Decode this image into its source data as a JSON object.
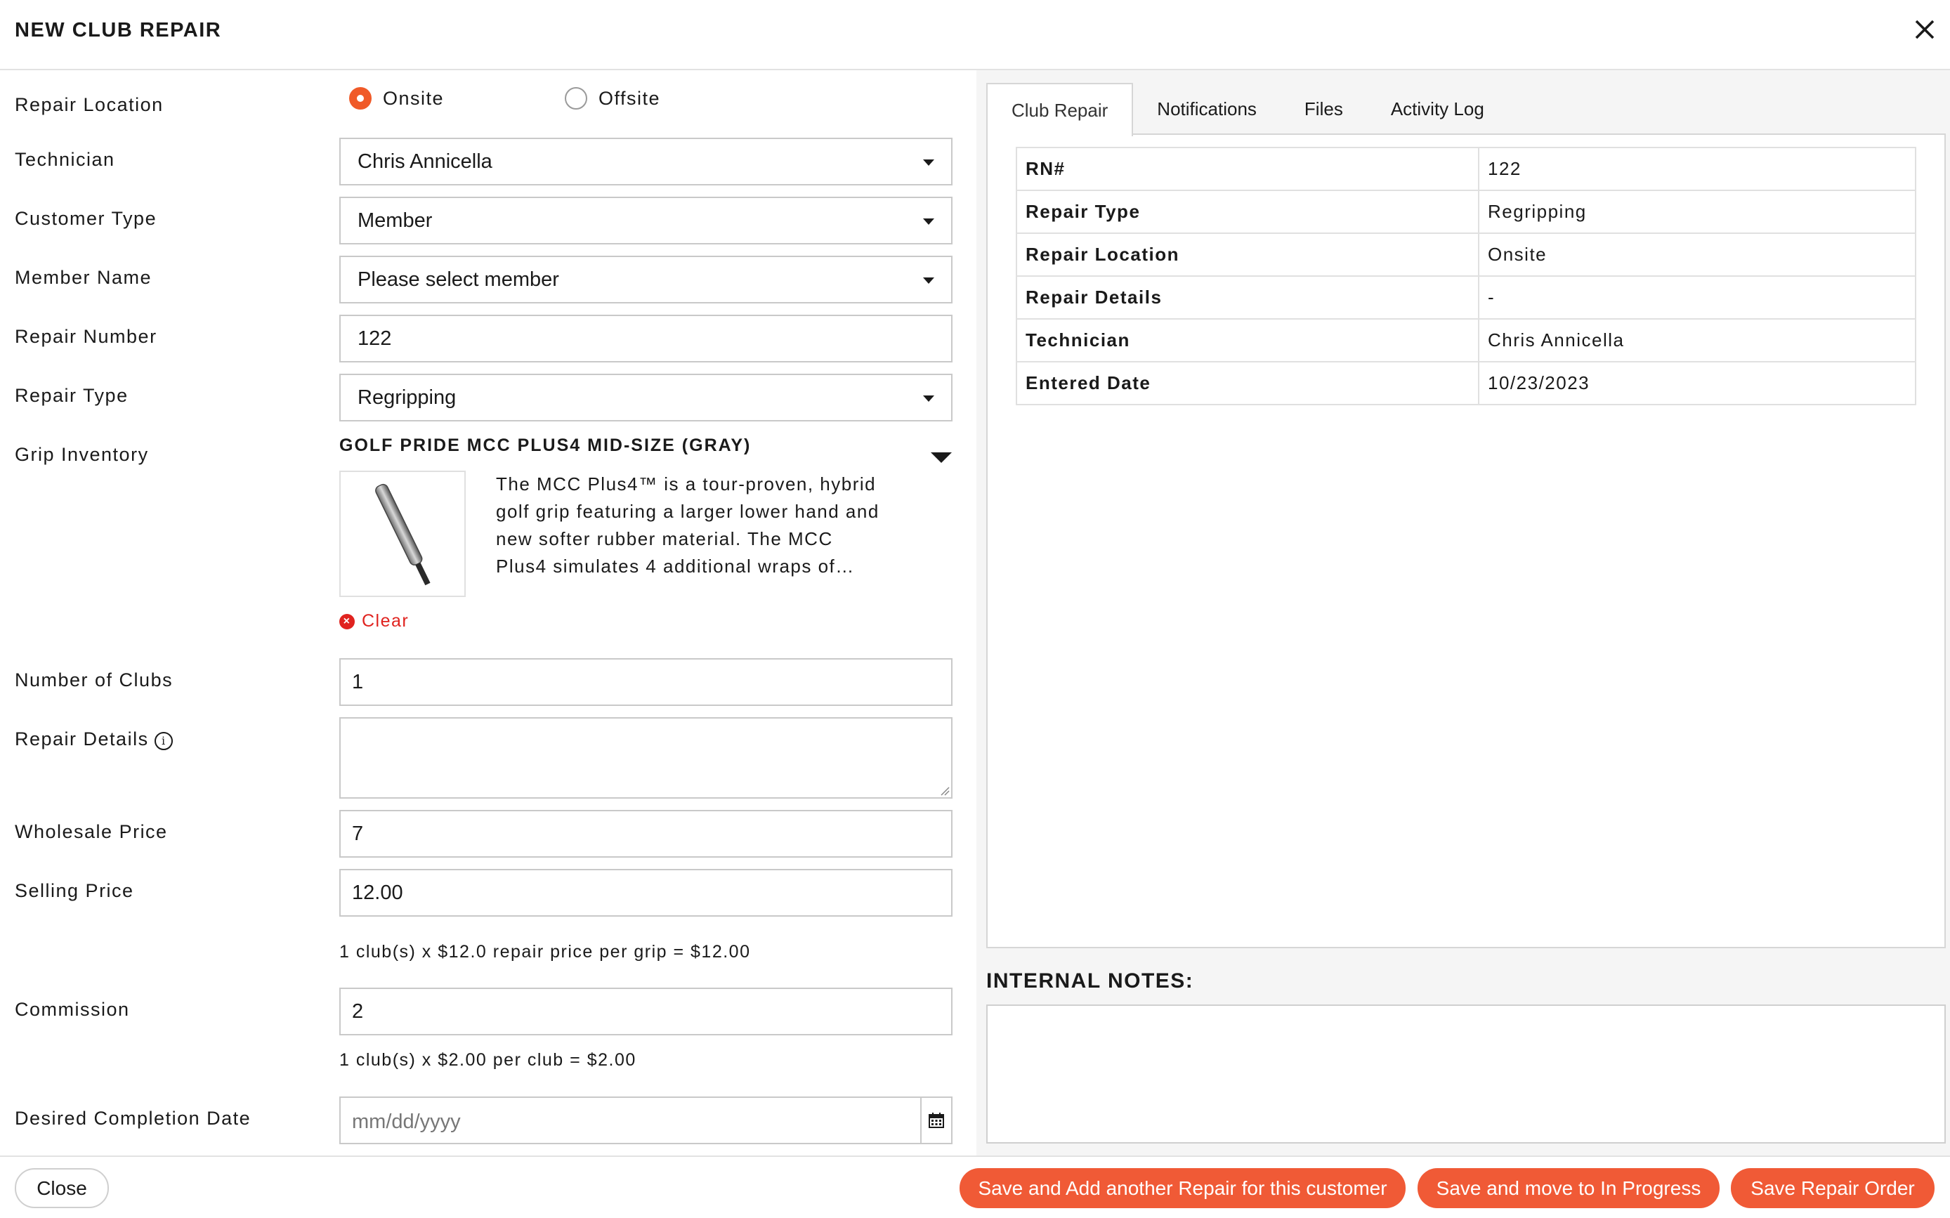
{
  "dialog": {
    "title": "NEW CLUB REPAIR"
  },
  "form": {
    "repair_location": {
      "label": "Repair Location",
      "options": [
        "Onsite",
        "Offsite"
      ],
      "selected": "Onsite"
    },
    "technician": {
      "label": "Technician",
      "value": "Chris Annicella"
    },
    "customer_type": {
      "label": "Customer Type",
      "value": "Member"
    },
    "member_name": {
      "label": "Member Name",
      "value": "Please select member"
    },
    "repair_number": {
      "label": "Repair Number",
      "value": "122"
    },
    "repair_type": {
      "label": "Repair Type",
      "value": "Regripping"
    },
    "grip_inventory": {
      "label": "Grip Inventory",
      "name": "GOLF PRIDE MCC PLUS4 MID-SIZE (GRAY)",
      "description": "The MCC Plus4™ is a tour-proven, hybrid golf grip featuring a larger lower hand and new softer rubber material. The MCC Plus4 simulates 4 additional wraps of…",
      "clear_label": "Clear"
    },
    "number_of_clubs": {
      "label": "Number of Clubs",
      "value": "1"
    },
    "repair_details": {
      "label": "Repair Details",
      "value": ""
    },
    "wholesale_price": {
      "label": "Wholesale Price",
      "value": "7"
    },
    "selling_price": {
      "label": "Selling Price",
      "value": "12.00",
      "calc": "1 club(s) x $12.0 repair price per grip = $12.00"
    },
    "commission": {
      "label": "Commission",
      "value": "2",
      "calc": "1 club(s) x $2.00 per club = $2.00"
    },
    "desired_completion_date": {
      "label": "Desired Completion Date",
      "placeholder": "mm/dd/yyyy"
    }
  },
  "tabs": [
    "Club Repair",
    "Notifications",
    "Files",
    "Activity Log"
  ],
  "active_tab": "Club Repair",
  "summary": [
    {
      "key": "RN#",
      "value": "122"
    },
    {
      "key": "Repair Type",
      "value": "Regripping"
    },
    {
      "key": "Repair Location",
      "value": "Onsite"
    },
    {
      "key": "Repair Details",
      "value": "-"
    },
    {
      "key": "Technician",
      "value": "Chris Annicella"
    },
    {
      "key": "Entered Date",
      "value": "10/23/2023"
    }
  ],
  "internal_notes": {
    "title": "INTERNAL NOTES:",
    "value": ""
  },
  "footer": {
    "close": "Close",
    "save_add_another": "Save and Add another Repair for this customer",
    "save_in_progress": "Save and move to In Progress",
    "save_order": "Save Repair Order"
  },
  "colors": {
    "accent": "#f05a36",
    "clear": "#e0231f"
  }
}
